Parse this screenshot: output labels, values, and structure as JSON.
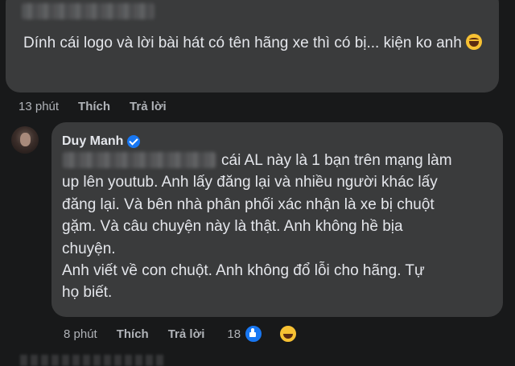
{
  "comment1": {
    "text": "Dính cái logo và lời bài hát có tên hãng xe thì có bị... kiện ko anh",
    "time": "13 phút",
    "like_label": "Thích",
    "reply_label": "Trả lời"
  },
  "comment2": {
    "author": "Duy Manh",
    "lines": [
      "cái AL này là 1 bạn trên mạng làm",
      "up lên youtub. Anh lấy đăng lại và nhiều người khác lấy",
      "đăng lại. Và bên nhà phân phối xác nhận là xe bị chuột",
      "gặm. Và câu chuyện này là thật. Anh không hề bịa",
      "chuyện.",
      "Anh viết về con chuột. Anh không đổ lỗi cho hãng. Tự",
      "họ biết."
    ],
    "time": "8 phút",
    "like_label": "Thích",
    "reply_label": "Trả lời",
    "reaction_count": "18",
    "reactions": [
      "like-icon",
      "haha-icon"
    ]
  },
  "colors": {
    "background": "#18191a",
    "bubble": "#3a3b3c",
    "text": "#e4e6eb",
    "secondary": "#b0b3b8",
    "verified": "#1877f2"
  }
}
